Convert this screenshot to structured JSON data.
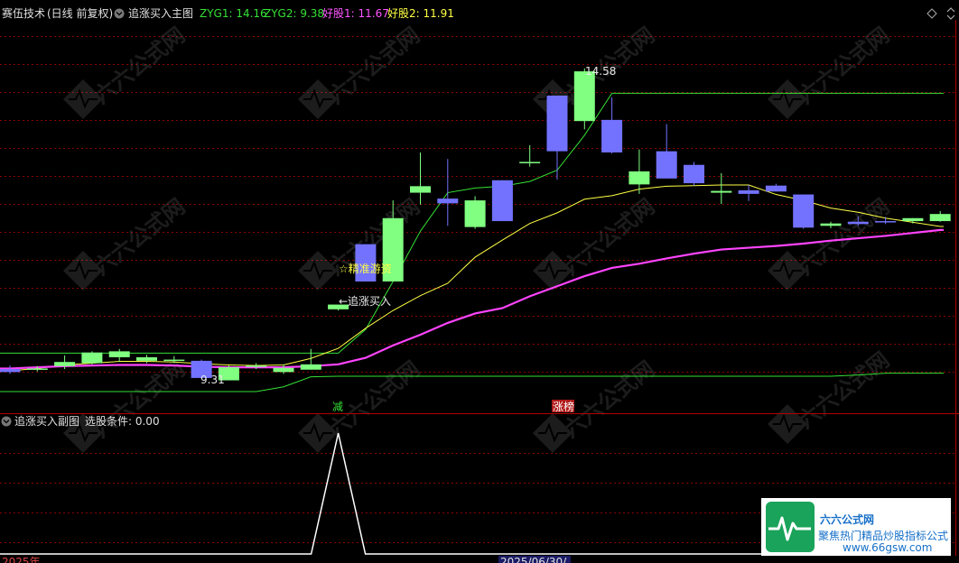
{
  "main_panel": {
    "stock_name": "赛伍技术",
    "mode": "(日线 前复权)",
    "indicator_name": "追涨买入主图",
    "legend": [
      {
        "label": "ZYG1: 14.16",
        "color": "#35e035"
      },
      {
        "label": "ZYG2: 9.38",
        "color": "#35e035"
      },
      {
        "label": "好股1: 11.67",
        "color": "#ff55ff"
      },
      {
        "label": "好股2: 11.91",
        "color": "#ffff44"
      }
    ],
    "marker_high": "14.58",
    "marker_low": "9.31",
    "signal_precise": "☆精准游资",
    "signal_buy": "←追涨买入",
    "tag_reduce": "减",
    "tag_limitup": "涨榜"
  },
  "sub_panel": {
    "indicator_name": "追涨买入副图",
    "condition_label": "选股条件: 0.00"
  },
  "footer": {
    "year_label": "2025年",
    "date_label": "2025/06/30/"
  },
  "watermark": {
    "brand": "六六公式网",
    "slogan": "聚焦热门精品炒股指标公式",
    "site": "www.66gsw.com"
  },
  "colors": {
    "up": "#80ff80",
    "down": "#7272ff",
    "zyg": "#35e035",
    "haogu1": "#ff44ff",
    "haogu2": "#ffff44",
    "grid": "#8b0000"
  },
  "chart_data": {
    "type": "candlestick",
    "price_ylim": [
      8.8,
      15.4
    ],
    "candles": [
      {
        "o": 9.5,
        "h": 9.56,
        "l": 9.42,
        "c": 9.45
      },
      {
        "o": 9.5,
        "h": 9.55,
        "l": 9.46,
        "c": 9.51
      },
      {
        "o": 9.55,
        "h": 9.73,
        "l": 9.5,
        "c": 9.62
      },
      {
        "o": 9.6,
        "h": 9.8,
        "l": 9.58,
        "c": 9.78
      },
      {
        "o": 9.7,
        "h": 9.84,
        "l": 9.62,
        "c": 9.8
      },
      {
        "o": 9.64,
        "h": 9.74,
        "l": 9.6,
        "c": 9.7
      },
      {
        "o": 9.64,
        "h": 9.72,
        "l": 9.6,
        "c": 9.66
      },
      {
        "o": 9.64,
        "h": 9.66,
        "l": 9.34,
        "c": 9.35
      },
      {
        "o": 9.31,
        "h": 9.56,
        "l": 9.31,
        "c": 9.53
      },
      {
        "o": 9.54,
        "h": 9.6,
        "l": 9.5,
        "c": 9.56
      },
      {
        "o": 9.45,
        "h": 9.58,
        "l": 9.42,
        "c": 9.52
      },
      {
        "o": 9.49,
        "h": 9.84,
        "l": 9.49,
        "c": 9.58
      },
      {
        "o": 10.51,
        "h": 10.57,
        "l": 10.49,
        "c": 10.59
      },
      {
        "o": 11.61,
        "h": 11.61,
        "l": 10.98,
        "c": 10.98
      },
      {
        "o": 10.98,
        "h": 12.35,
        "l": 10.98,
        "c": 12.05
      },
      {
        "o": 12.48,
        "h": 13.16,
        "l": 12.28,
        "c": 12.59
      },
      {
        "o": 12.38,
        "h": 13.05,
        "l": 11.92,
        "c": 12.3
      },
      {
        "o": 11.9,
        "h": 12.42,
        "l": 11.87,
        "c": 12.35
      },
      {
        "o": 12.69,
        "h": 12.69,
        "l": 12.0,
        "c": 12.0
      },
      {
        "o": 13.0,
        "h": 13.28,
        "l": 12.92,
        "c": 13.0
      },
      {
        "o": 14.12,
        "h": 14.12,
        "l": 12.7,
        "c": 13.18
      },
      {
        "o": 13.69,
        "h": 14.58,
        "l": 13.55,
        "c": 14.53
      },
      {
        "o": 13.71,
        "h": 14.09,
        "l": 13.14,
        "c": 13.16
      },
      {
        "o": 12.62,
        "h": 13.21,
        "l": 12.46,
        "c": 12.84
      },
      {
        "o": 13.18,
        "h": 13.64,
        "l": 12.73,
        "c": 12.72
      },
      {
        "o": 12.95,
        "h": 13.0,
        "l": 12.6,
        "c": 12.64
      },
      {
        "o": 12.48,
        "h": 12.81,
        "l": 12.29,
        "c": 12.51
      },
      {
        "o": 12.52,
        "h": 12.61,
        "l": 12.34,
        "c": 12.46
      },
      {
        "o": 12.6,
        "h": 12.63,
        "l": 12.5,
        "c": 12.5
      },
      {
        "o": 12.45,
        "h": 12.45,
        "l": 11.87,
        "c": 11.89
      },
      {
        "o": 11.92,
        "h": 11.99,
        "l": 11.88,
        "c": 11.96
      },
      {
        "o": 11.99,
        "h": 12.08,
        "l": 11.92,
        "c": 11.95
      },
      {
        "o": 12.0,
        "h": 12.07,
        "l": 11.95,
        "c": 11.98
      },
      {
        "o": 12.0,
        "h": 12.05,
        "l": 11.96,
        "c": 12.05
      },
      {
        "o": 12.0,
        "h": 12.17,
        "l": 11.99,
        "c": 12.12
      }
    ],
    "zyg1": [
      9.77,
      9.77,
      9.77,
      9.77,
      9.77,
      9.77,
      9.77,
      9.77,
      9.77,
      9.77,
      9.77,
      9.77,
      9.77,
      10.17,
      10.98,
      11.83,
      12.48,
      12.56,
      12.59,
      12.67,
      12.86,
      13.45,
      14.16,
      14.16,
      14.16,
      14.16,
      14.16,
      14.16,
      14.16,
      14.16,
      14.16,
      14.16,
      14.16,
      14.16,
      14.16
    ],
    "zyg2": [
      9.12,
      9.12,
      9.12,
      9.12,
      9.12,
      9.12,
      9.12,
      9.12,
      9.12,
      9.12,
      9.2,
      9.37,
      9.38,
      9.38,
      9.38,
      9.38,
      9.38,
      9.38,
      9.38,
      9.38,
      9.38,
      9.38,
      9.38,
      9.38,
      9.38,
      9.38,
      9.38,
      9.38,
      9.38,
      9.38,
      9.38,
      9.4,
      9.43,
      9.43,
      9.43
    ],
    "haogu1": [
      9.51,
      9.53,
      9.55,
      9.56,
      9.57,
      9.57,
      9.56,
      9.54,
      9.53,
      9.53,
      9.53,
      9.55,
      9.58,
      9.69,
      9.9,
      10.08,
      10.28,
      10.44,
      10.53,
      10.73,
      10.9,
      11.07,
      11.21,
      11.28,
      11.37,
      11.45,
      11.52,
      11.55,
      11.58,
      11.62,
      11.67,
      11.71,
      11.75,
      11.8,
      11.85
    ],
    "haogu2": [
      9.47,
      9.51,
      9.57,
      9.6,
      9.63,
      9.63,
      9.62,
      9.59,
      9.57,
      9.56,
      9.57,
      9.68,
      9.85,
      10.19,
      10.49,
      10.74,
      10.95,
      11.39,
      11.68,
      11.96,
      12.14,
      12.37,
      12.43,
      12.54,
      12.59,
      12.6,
      12.61,
      12.61,
      12.45,
      12.35,
      12.22,
      12.15,
      12.05,
      11.98,
      11.91
    ],
    "sub_signal": [
      0,
      0,
      0,
      0,
      0,
      0,
      0,
      0,
      0,
      0,
      0,
      0,
      1,
      0,
      0,
      0,
      0,
      0,
      0,
      0,
      0,
      0,
      0,
      0,
      0,
      0,
      0,
      0,
      0,
      0,
      0,
      0,
      0,
      0,
      0
    ]
  }
}
